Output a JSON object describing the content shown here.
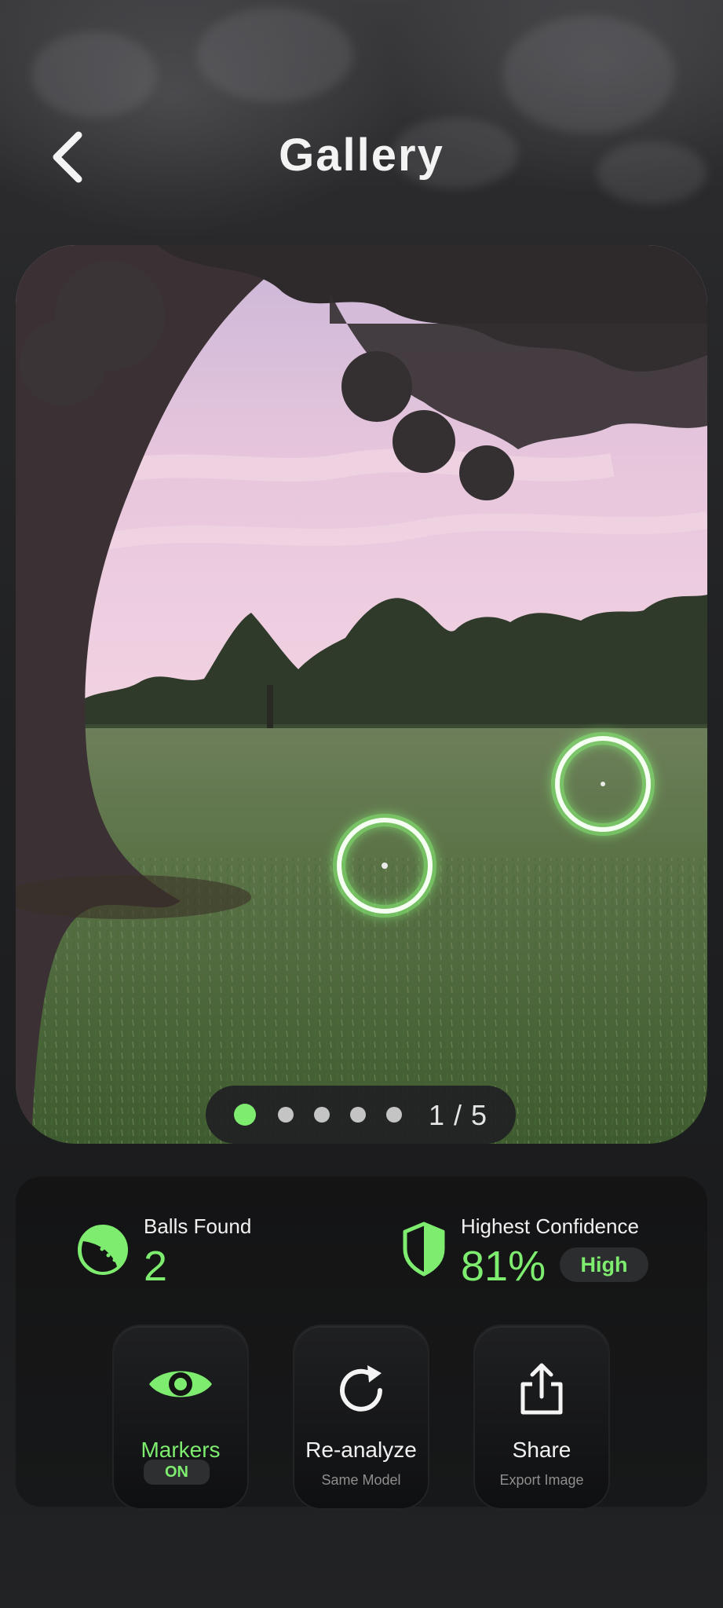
{
  "header": {
    "title": "Gallery",
    "back_icon": "chevron-left-icon"
  },
  "photo": {
    "description_icon": "golf-course-photo",
    "markers": [
      {
        "name": "ball-marker-1"
      },
      {
        "name": "ball-marker-2"
      }
    ]
  },
  "pager": {
    "current": 1,
    "total": 5,
    "count_text": "1 / 5"
  },
  "stats": {
    "balls_found": {
      "label": "Balls Found",
      "value": "2",
      "icon": "golf-ball-icon"
    },
    "highest_confidence": {
      "label": "Highest Confidence",
      "value": "81%",
      "level": "High",
      "icon": "shield-icon"
    }
  },
  "actions": [
    {
      "label": "Markers",
      "state": "ON",
      "icon": "eye-icon"
    },
    {
      "label": "Re-analyze",
      "sub": "Same Model",
      "icon": "refresh-icon"
    },
    {
      "label": "Share",
      "sub": "Export Image",
      "icon": "share-icon"
    }
  ],
  "colors": {
    "accent": "#7dec6f",
    "panel": "#141415",
    "background": "#1f2022"
  }
}
